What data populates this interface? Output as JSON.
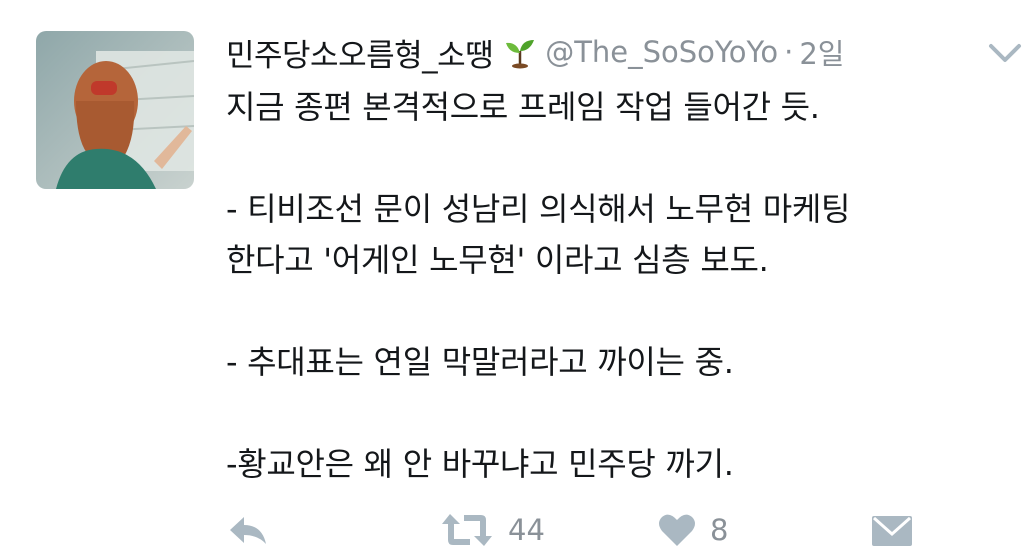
{
  "tweet": {
    "display_name": "민주당소오름형_소땡",
    "handle": "@The_SoSoYoYo",
    "separator": "·",
    "time": "2일",
    "lines": [
      "지금 종편 본격적으로 프레임 작업 들어간 듯.",
      "",
      "- 티비조선 문이 성남리 의식해서 노무현 마케팅",
      "한다고 '어게인 노무현' 이라고 심층 보도.",
      "",
      "- 추대표는 연일 막말러라고 까이는 중.",
      "",
      "-황교안은 왜 안 바꾸냐고 민주당 까기."
    ]
  },
  "actions": {
    "retweet_count": "44",
    "like_count": "8"
  },
  "icons": {
    "name_emoji": "sprout-icon",
    "menu": "chevron-down-icon",
    "reply": "reply-icon",
    "retweet": "retweet-icon",
    "like": "heart-icon",
    "dm": "envelope-icon"
  },
  "colors": {
    "text": "#14171a",
    "muted": "#8a9198",
    "icon": "#aab8c2"
  }
}
